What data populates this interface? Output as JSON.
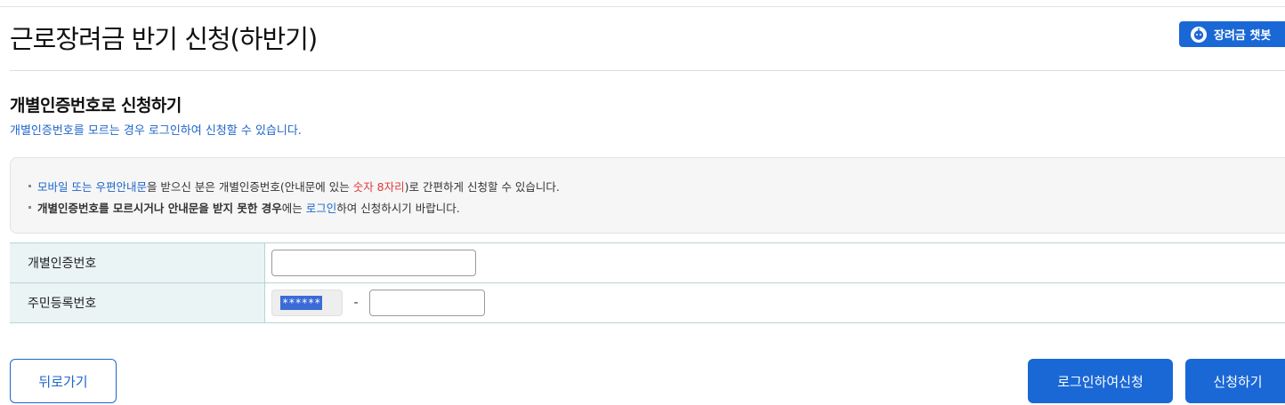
{
  "page": {
    "title": "근로장려금 반기 신청(하반기)",
    "chatbot_label": "장려금 챗봇"
  },
  "section": {
    "title": "개별인증번호로 신청하기",
    "subtitle": "개별인증번호를 모르는 경우 로그인하여 신청할 수 있습니다."
  },
  "notice": {
    "line1": {
      "blue1": "모바일 또는 우편안내문",
      "text1": "을 받으신 분은 개별인증번호(안내문에 있는 ",
      "red": "숫자 8자리",
      "text2": ")로 간편하게 신청할 수 있습니다."
    },
    "line2": {
      "bold": "개별인증번호를 모르시거나 안내문을 받지 못한 경우",
      "text1": "에는 ",
      "blue": "로그인",
      "text2": "하여 신청하시기 바랍니다."
    }
  },
  "form": {
    "auth_label": "개별인증번호",
    "auth_value": "",
    "rrn_label": "주민등록번호",
    "rrn_front_masked": "******",
    "rrn_separator": "-",
    "rrn_back_value": ""
  },
  "buttons": {
    "back": "뒤로가기",
    "login_apply": "로그인하여신청",
    "apply": "신청하기"
  },
  "colors": {
    "primary": "#1a68d6",
    "link": "#1f66c9",
    "highlight": "#e03a3a",
    "table_label_bg": "#eaf4f4"
  }
}
